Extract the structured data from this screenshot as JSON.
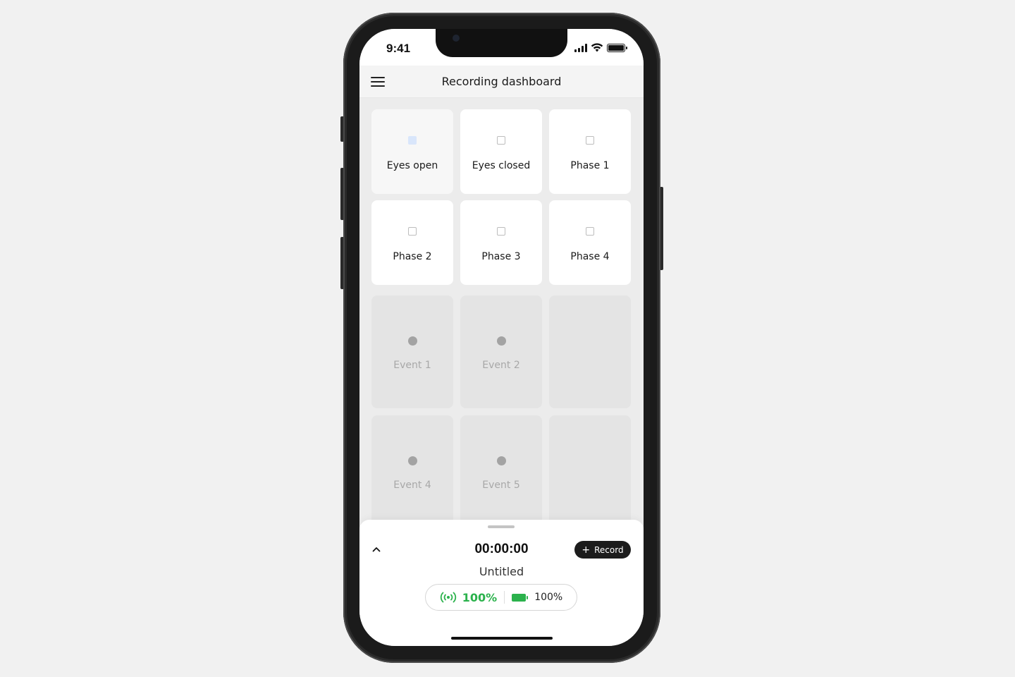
{
  "status_bar": {
    "time": "9:41"
  },
  "header": {
    "title": "Recording dashboard"
  },
  "tiles": [
    {
      "label": "Eyes open",
      "active": true
    },
    {
      "label": "Eyes closed",
      "active": false
    },
    {
      "label": "Phase 1",
      "active": false
    },
    {
      "label": "Phase 2",
      "active": false
    },
    {
      "label": "Phase 3",
      "active": false
    },
    {
      "label": "Phase 4",
      "active": false
    }
  ],
  "events": [
    {
      "label": "Event 1"
    },
    {
      "label": "Event 2"
    },
    {
      "label": ""
    },
    {
      "label": "Event 4"
    },
    {
      "label": "Event 5"
    },
    {
      "label": ""
    }
  ],
  "sheet": {
    "timer": "00:00:00",
    "record_label": "Record",
    "file_name": "Untitled",
    "signal_strength": "100%",
    "battery_level": "100%"
  },
  "icons": {
    "menu": "hamburger-menu-icon",
    "signal": "cellular-signal-icon",
    "wifi": "wifi-icon",
    "battery": "battery-icon",
    "chevron": "chevron-up-icon",
    "plus": "plus-icon",
    "broadcast": "broadcast-signal-icon",
    "device_battery": "device-battery-icon"
  },
  "colors": {
    "accent_green": "#2bb24c",
    "active_checkbox": "#d9e6fb",
    "record_button": "#1c1c1c"
  }
}
